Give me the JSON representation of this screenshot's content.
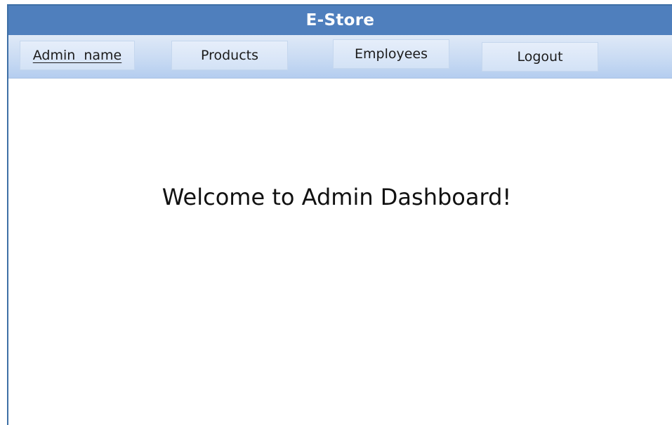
{
  "header": {
    "title": "E-Store"
  },
  "nav": {
    "admin_name": "Admin  name",
    "products": "Products",
    "employees": "Employees",
    "logout": "Logout"
  },
  "main": {
    "welcome": "Welcome to Admin Dashboard!"
  },
  "colors": {
    "title_bar": "#4f7fbd",
    "nav_gradient_top": "#dfe9f7",
    "nav_gradient_bottom": "#b4cdef",
    "frame_border": "#3e6fa6"
  }
}
